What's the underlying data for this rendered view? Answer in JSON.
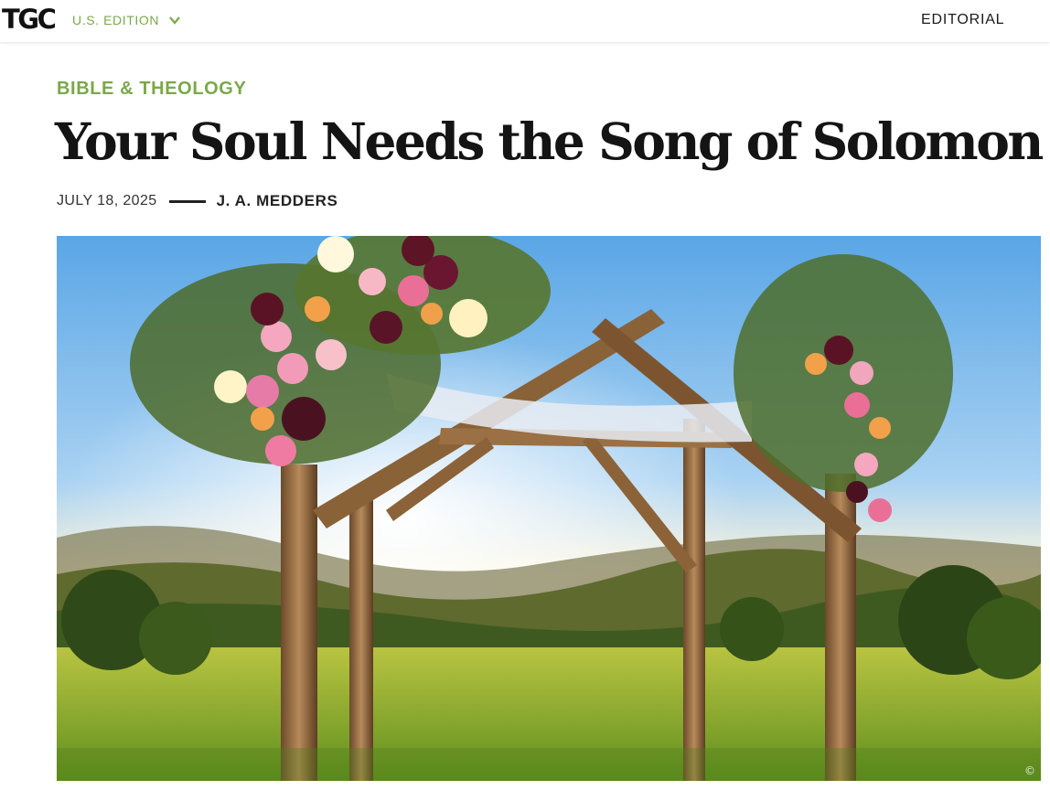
{
  "header": {
    "logo_text": "TGC",
    "edition_label": "U.S. EDITION",
    "edition_chevron_icon": "chevron-down-icon",
    "nav_editorial": "EDITORIAL",
    "accent_color": "#7aa84a"
  },
  "article": {
    "category": "BIBLE & THEOLOGY",
    "title": "Your Soul Needs the Song of Solomon",
    "date": "JULY 18, 2025",
    "author": "J. A. MEDDERS",
    "hero_image": {
      "description_icon": "wedding-arch-photo",
      "copyright_symbol": "©"
    }
  }
}
